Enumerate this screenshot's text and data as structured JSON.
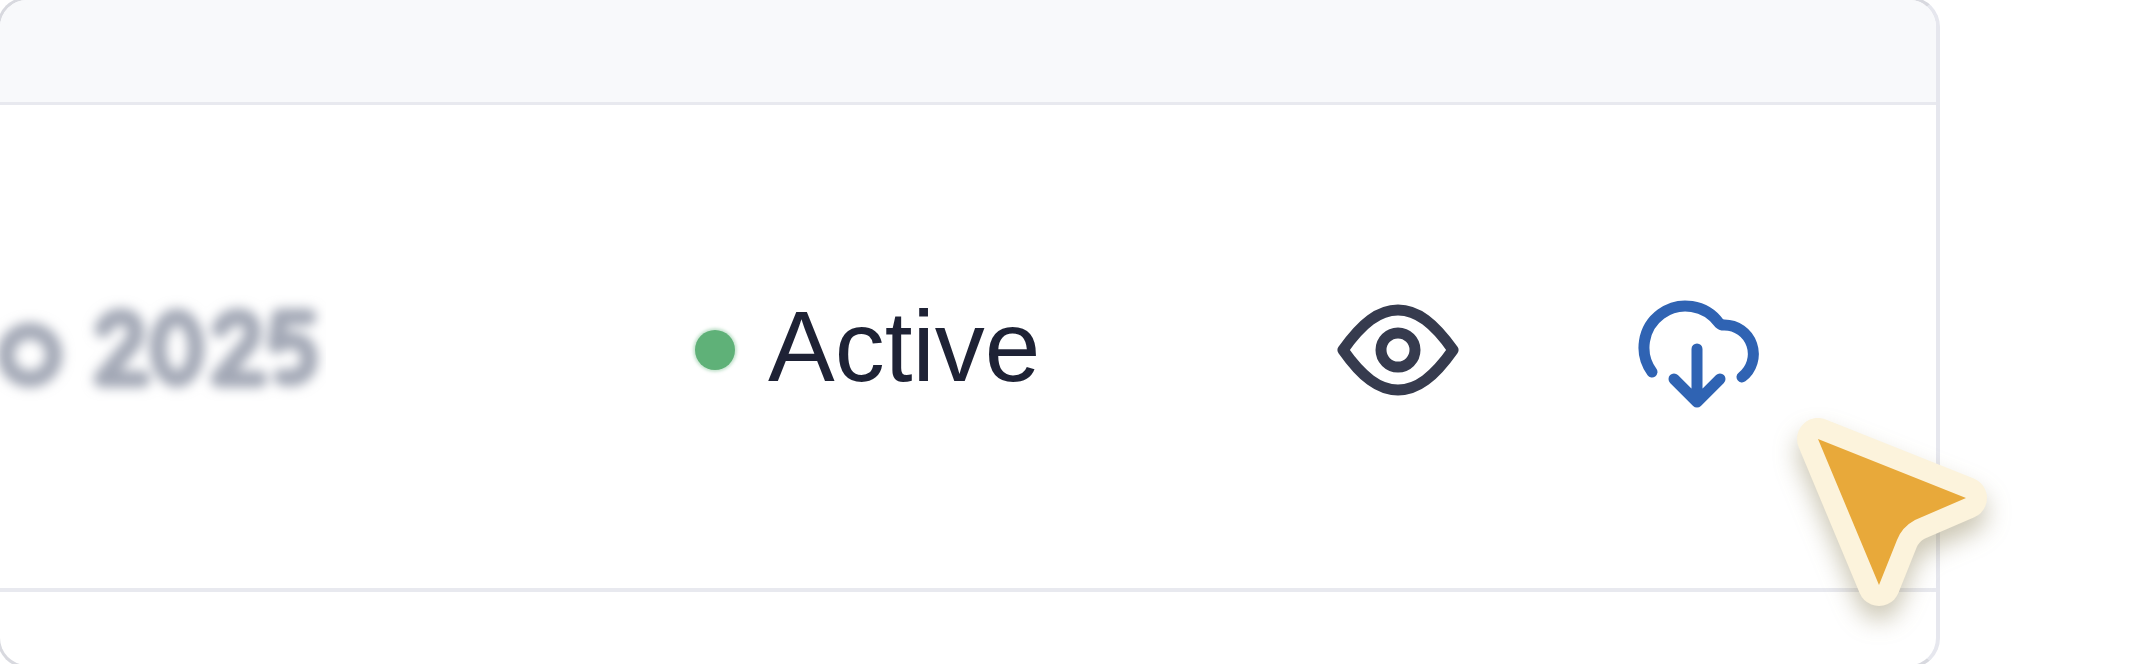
{
  "table": {
    "rows": [
      {
        "status": {
          "label": "Active",
          "color": "#5fb178"
        }
      }
    ]
  }
}
